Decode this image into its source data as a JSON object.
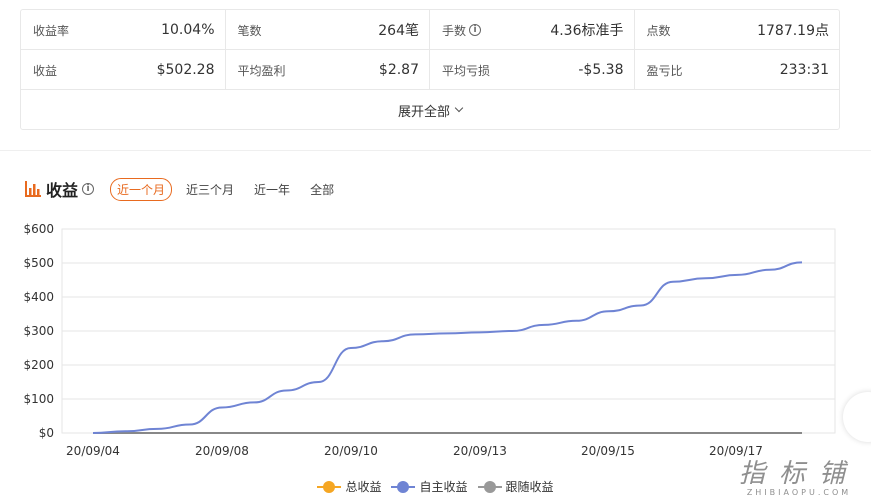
{
  "stats": {
    "row1": [
      {
        "label": "收益率",
        "value": "10.04%"
      },
      {
        "label": "笔数",
        "value": "264笔"
      },
      {
        "label": "手数",
        "value": "4.36标准手",
        "info": true
      },
      {
        "label": "点数",
        "value": "1787.19点"
      }
    ],
    "row2": [
      {
        "label": "收益",
        "value": "$502.28"
      },
      {
        "label": "平均盈利",
        "value": "$2.87"
      },
      {
        "label": "平均亏损",
        "value": "-$5.38"
      },
      {
        "label": "盈亏比",
        "value": "233:31"
      }
    ],
    "expand_label": "展开全部"
  },
  "section": {
    "title": "收益",
    "tabs": [
      "近一个月",
      "近三个月",
      "近一年",
      "全部"
    ],
    "active_tab": 0
  },
  "colors": {
    "accent": "#e86a1f",
    "series_total": "#f5a623",
    "series_self": "#6f84d4",
    "series_follow": "#999999"
  },
  "chart_data": {
    "type": "line",
    "y_ticks": [
      "$0",
      "$100",
      "$200",
      "$300",
      "$400",
      "$500",
      "$600"
    ],
    "ylim": [
      0,
      600
    ],
    "x_labels": [
      "20/09/04",
      "20/09/08",
      "20/09/10",
      "20/09/13",
      "20/09/15",
      "20/09/17"
    ],
    "grid": true,
    "legend_position": "bottom-center",
    "series": [
      {
        "name": "总收益",
        "values": [
          0,
          0,
          0,
          0,
          0,
          0,
          0,
          0,
          0,
          0,
          0,
          0,
          0,
          0,
          0,
          0,
          0,
          0,
          0,
          0,
          0,
          0
        ]
      },
      {
        "name": "自主收益",
        "values": [
          0,
          5,
          12,
          25,
          75,
          90,
          125,
          150,
          250,
          270,
          290,
          293,
          296,
          300,
          318,
          330,
          358,
          375,
          445,
          455,
          465,
          480,
          502
        ]
      },
      {
        "name": "跟随收益",
        "values": [
          0,
          0,
          0,
          0,
          0,
          0,
          0,
          0,
          0,
          0,
          0,
          0,
          0,
          0,
          0,
          0,
          0,
          0,
          0,
          0,
          0,
          0
        ]
      }
    ]
  },
  "watermark": {
    "main": "指标铺",
    "sub": "ZHIBIAOPU.COM"
  }
}
